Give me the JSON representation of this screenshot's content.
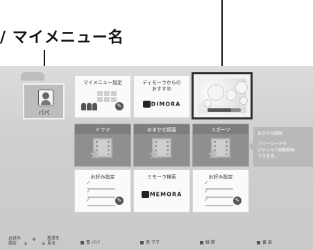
{
  "callout": {
    "label": "/ マイメニュー名"
  },
  "user": {
    "name": "パパ",
    "icon": "user-avatar-icon"
  },
  "tiles": {
    "my_menu_settings": {
      "label": "マイメニュー設定"
    },
    "recommend": {
      "label": "ディモーラからの\nおすすめ",
      "brand": "DIMORA"
    },
    "drama": {
      "label": "ドラマ"
    },
    "omakase": {
      "label": "おまかせ録画"
    },
    "sports": {
      "label": "スポーツ"
    },
    "fav1": {
      "label": "お好み設定"
    },
    "mimora_search": {
      "label": "ミモーラ検索",
      "brand": "MEMORA"
    },
    "fav2": {
      "label": "お好み設定"
    }
  },
  "preview": {
    "progress": 0.7
  },
  "tooltip": {
    "title": "おまかせ録画",
    "body": "フリーワードや\nジャンルで自動録画\nできます。"
  },
  "bottom": {
    "left1": "お好み\n設定",
    "key_a": "⑤",
    "key_b": "⑥",
    "left2": "放送を\n見る",
    "blue": "青 パパ",
    "red": "赤 ママ",
    "green": "緑 姉",
    "yellow": "黄 弟"
  },
  "colors": {
    "screen_bg": "#cfcfcf",
    "selected_border": "#2f2f2f",
    "dark_tile": "#8f8f8f"
  }
}
